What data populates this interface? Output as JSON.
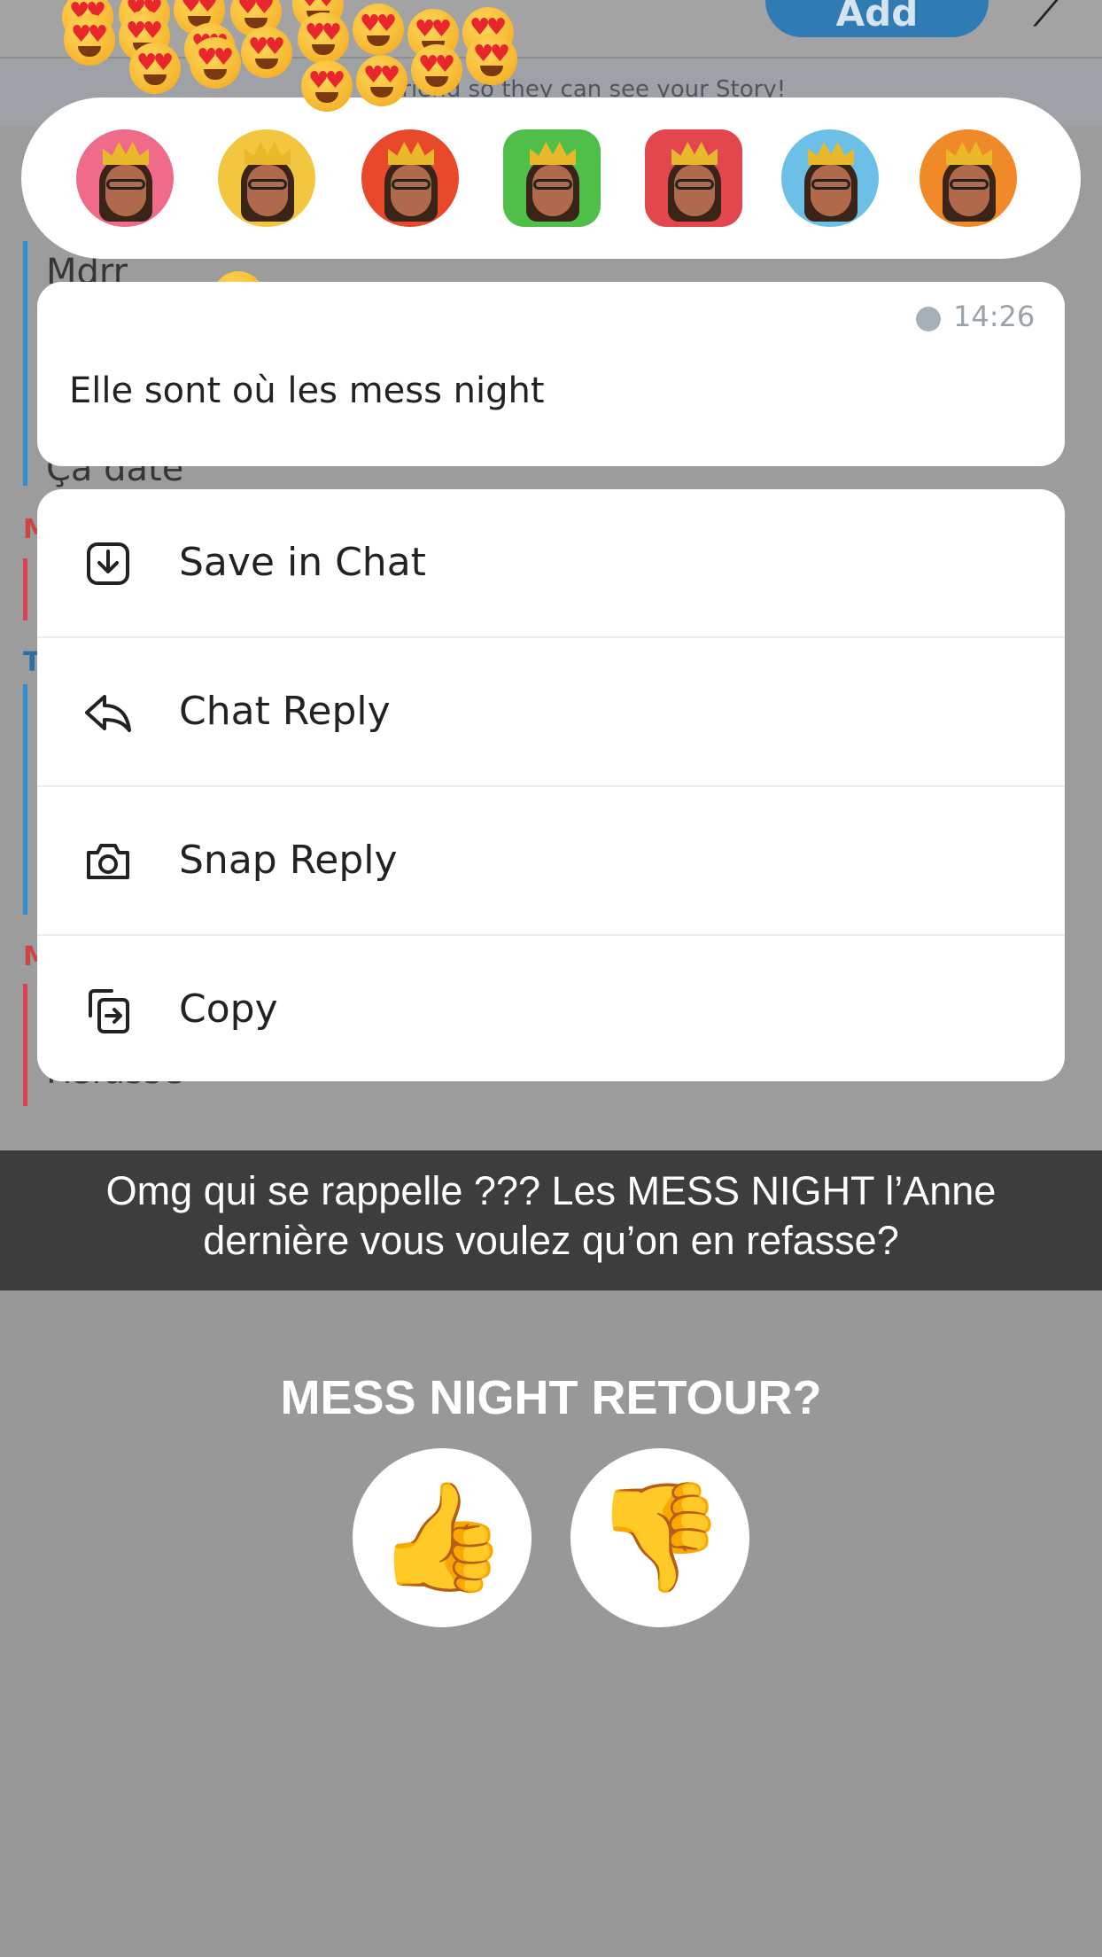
{
  "header": {
    "add_label": "Add",
    "banner_text": "a friend so they can see your Story!"
  },
  "background_chat": [
    {
      "text": "Mdrr"
    },
    {
      "text": "Ça date"
    },
    {
      "text": "Refasse"
    }
  ],
  "reactions": [
    {
      "name": "love",
      "extra": "♥"
    },
    {
      "name": "laugh",
      "extra": "💧"
    },
    {
      "name": "fire",
      "extra": "🔥"
    },
    {
      "name": "thumbs-up",
      "extra": "👍"
    },
    {
      "name": "thumbs-down",
      "extra": "👎"
    },
    {
      "name": "sad",
      "extra": "💧"
    },
    {
      "name": "mind-blown",
      "extra": "💥"
    }
  ],
  "message": {
    "time": "14:26",
    "text": "Elle sont où les mess night"
  },
  "menu": {
    "items": [
      {
        "label": "Save in Chat",
        "icon": "save-in-chat-icon"
      },
      {
        "label": "Chat Reply",
        "icon": "reply-arrow-icon"
      },
      {
        "label": "Snap Reply",
        "icon": "camera-icon"
      },
      {
        "label": "Copy",
        "icon": "copy-icon"
      }
    ]
  },
  "caption": {
    "text": "Omg qui se rappelle ??? Les MESS NIGHT l’Anne dernière vous voulez qu’on en refasse?"
  },
  "poll": {
    "title": "MESS NIGHT RETOUR?",
    "yes_glyph": "👍",
    "no_glyph": "👎"
  },
  "colors": {
    "accent_blue": "#2f7cb5",
    "chat_bar_blue": "#2c8dd8",
    "chat_bar_red": "#e04050"
  }
}
